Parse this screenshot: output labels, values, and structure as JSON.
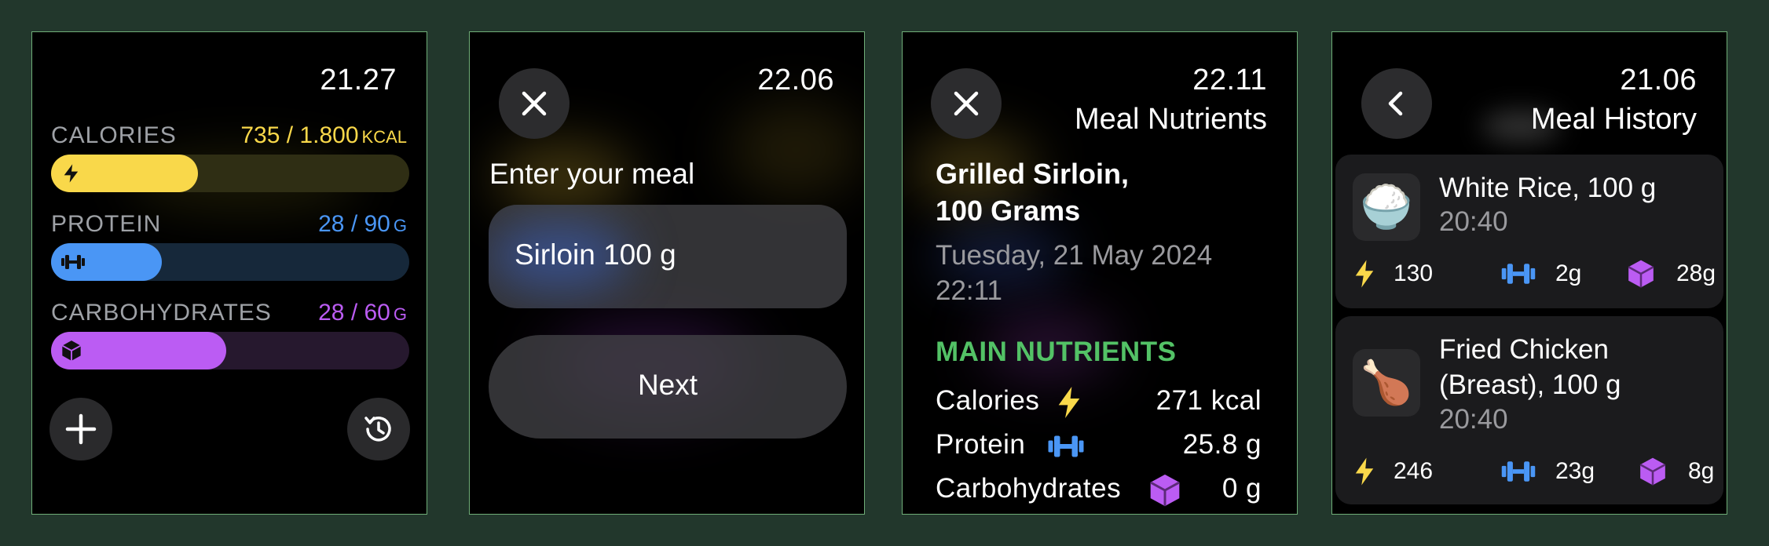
{
  "screens": {
    "dashboard": {
      "time": "21.27",
      "bars": [
        {
          "label": "CALORIES",
          "value": "735 / 1.800",
          "unit": "KCAL",
          "color": "#f9d84a",
          "track": "#2f2e14",
          "progress": 0.41,
          "icon": "lightning-icon"
        },
        {
          "label": "PROTEIN",
          "value": "28 / 90",
          "unit": "G",
          "color": "#4a96f5",
          "track": "#16283a",
          "progress": 0.31,
          "icon": "dumbbell-icon"
        },
        {
          "label": "CARBOHYDRATES",
          "value": "28 / 60",
          "unit": "G",
          "color": "#bb5cf3",
          "track": "#26182e",
          "progress": 0.49,
          "icon": "cube-icon"
        }
      ],
      "add_icon": "plus-icon",
      "history_icon": "history-icon"
    },
    "enter_meal": {
      "time": "22.06",
      "prompt": "Enter your meal",
      "input_value": "Sirloin 100 g",
      "next_label": "Next",
      "close_icon": "close-icon"
    },
    "meal_nutrients": {
      "time": "22.11",
      "title": "Meal Nutrients",
      "meal_name_line1": "Grilled Sirloin,",
      "meal_name_line2": "100 Grams",
      "date": "Tuesday, 21 May 2024",
      "clock": "22:11",
      "section": "MAIN NUTRIENTS",
      "section_color": "#53c266",
      "nutrients": [
        {
          "name": "Calories",
          "value": "271 kcal",
          "icon": "lightning-icon"
        },
        {
          "name": "Protein",
          "value": "25.8 g",
          "icon": "dumbbell-icon"
        },
        {
          "name": "Carbohydrates",
          "value": "0 g",
          "icon": "cube-icon"
        }
      ]
    },
    "meal_history": {
      "time": "21.06",
      "title": "Meal History",
      "back_icon": "chevron-left-icon",
      "meals": [
        {
          "name_line1": "White Rice, 100 g",
          "name_line2": "",
          "time": "20:40",
          "emoji": "🍚",
          "calories": "130",
          "protein": "2g",
          "carbs": "28g"
        },
        {
          "name_line1": "Fried Chicken",
          "name_line2": "(Breast), 100 g",
          "time": "20:40",
          "emoji": "🍗",
          "calories": "246",
          "protein": "23g",
          "carbs": "8g"
        }
      ]
    }
  }
}
